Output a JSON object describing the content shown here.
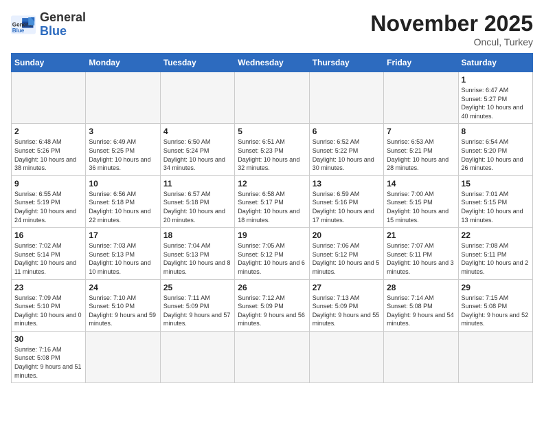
{
  "header": {
    "logo_text_general": "General",
    "logo_text_blue": "Blue",
    "month_year": "November 2025",
    "location": "Oncul, Turkey"
  },
  "weekdays": [
    "Sunday",
    "Monday",
    "Tuesday",
    "Wednesday",
    "Thursday",
    "Friday",
    "Saturday"
  ],
  "days": [
    {
      "num": "",
      "sunrise": "",
      "sunset": "",
      "daylight": "",
      "empty": true
    },
    {
      "num": "",
      "sunrise": "",
      "sunset": "",
      "daylight": "",
      "empty": true
    },
    {
      "num": "",
      "sunrise": "",
      "sunset": "",
      "daylight": "",
      "empty": true
    },
    {
      "num": "",
      "sunrise": "",
      "sunset": "",
      "daylight": "",
      "empty": true
    },
    {
      "num": "",
      "sunrise": "",
      "sunset": "",
      "daylight": "",
      "empty": true
    },
    {
      "num": "",
      "sunrise": "",
      "sunset": "",
      "daylight": "",
      "empty": true
    },
    {
      "num": "1",
      "sunrise": "Sunrise: 6:47 AM",
      "sunset": "Sunset: 5:27 PM",
      "daylight": "Daylight: 10 hours and 40 minutes.",
      "empty": false
    },
    {
      "num": "2",
      "sunrise": "Sunrise: 6:48 AM",
      "sunset": "Sunset: 5:26 PM",
      "daylight": "Daylight: 10 hours and 38 minutes.",
      "empty": false
    },
    {
      "num": "3",
      "sunrise": "Sunrise: 6:49 AM",
      "sunset": "Sunset: 5:25 PM",
      "daylight": "Daylight: 10 hours and 36 minutes.",
      "empty": false
    },
    {
      "num": "4",
      "sunrise": "Sunrise: 6:50 AM",
      "sunset": "Sunset: 5:24 PM",
      "daylight": "Daylight: 10 hours and 34 minutes.",
      "empty": false
    },
    {
      "num": "5",
      "sunrise": "Sunrise: 6:51 AM",
      "sunset": "Sunset: 5:23 PM",
      "daylight": "Daylight: 10 hours and 32 minutes.",
      "empty": false
    },
    {
      "num": "6",
      "sunrise": "Sunrise: 6:52 AM",
      "sunset": "Sunset: 5:22 PM",
      "daylight": "Daylight: 10 hours and 30 minutes.",
      "empty": false
    },
    {
      "num": "7",
      "sunrise": "Sunrise: 6:53 AM",
      "sunset": "Sunset: 5:21 PM",
      "daylight": "Daylight: 10 hours and 28 minutes.",
      "empty": false
    },
    {
      "num": "8",
      "sunrise": "Sunrise: 6:54 AM",
      "sunset": "Sunset: 5:20 PM",
      "daylight": "Daylight: 10 hours and 26 minutes.",
      "empty": false
    },
    {
      "num": "9",
      "sunrise": "Sunrise: 6:55 AM",
      "sunset": "Sunset: 5:19 PM",
      "daylight": "Daylight: 10 hours and 24 minutes.",
      "empty": false
    },
    {
      "num": "10",
      "sunrise": "Sunrise: 6:56 AM",
      "sunset": "Sunset: 5:18 PM",
      "daylight": "Daylight: 10 hours and 22 minutes.",
      "empty": false
    },
    {
      "num": "11",
      "sunrise": "Sunrise: 6:57 AM",
      "sunset": "Sunset: 5:18 PM",
      "daylight": "Daylight: 10 hours and 20 minutes.",
      "empty": false
    },
    {
      "num": "12",
      "sunrise": "Sunrise: 6:58 AM",
      "sunset": "Sunset: 5:17 PM",
      "daylight": "Daylight: 10 hours and 18 minutes.",
      "empty": false
    },
    {
      "num": "13",
      "sunrise": "Sunrise: 6:59 AM",
      "sunset": "Sunset: 5:16 PM",
      "daylight": "Daylight: 10 hours and 17 minutes.",
      "empty": false
    },
    {
      "num": "14",
      "sunrise": "Sunrise: 7:00 AM",
      "sunset": "Sunset: 5:15 PM",
      "daylight": "Daylight: 10 hours and 15 minutes.",
      "empty": false
    },
    {
      "num": "15",
      "sunrise": "Sunrise: 7:01 AM",
      "sunset": "Sunset: 5:15 PM",
      "daylight": "Daylight: 10 hours and 13 minutes.",
      "empty": false
    },
    {
      "num": "16",
      "sunrise": "Sunrise: 7:02 AM",
      "sunset": "Sunset: 5:14 PM",
      "daylight": "Daylight: 10 hours and 11 minutes.",
      "empty": false
    },
    {
      "num": "17",
      "sunrise": "Sunrise: 7:03 AM",
      "sunset": "Sunset: 5:13 PM",
      "daylight": "Daylight: 10 hours and 10 minutes.",
      "empty": false
    },
    {
      "num": "18",
      "sunrise": "Sunrise: 7:04 AM",
      "sunset": "Sunset: 5:13 PM",
      "daylight": "Daylight: 10 hours and 8 minutes.",
      "empty": false
    },
    {
      "num": "19",
      "sunrise": "Sunrise: 7:05 AM",
      "sunset": "Sunset: 5:12 PM",
      "daylight": "Daylight: 10 hours and 6 minutes.",
      "empty": false
    },
    {
      "num": "20",
      "sunrise": "Sunrise: 7:06 AM",
      "sunset": "Sunset: 5:12 PM",
      "daylight": "Daylight: 10 hours and 5 minutes.",
      "empty": false
    },
    {
      "num": "21",
      "sunrise": "Sunrise: 7:07 AM",
      "sunset": "Sunset: 5:11 PM",
      "daylight": "Daylight: 10 hours and 3 minutes.",
      "empty": false
    },
    {
      "num": "22",
      "sunrise": "Sunrise: 7:08 AM",
      "sunset": "Sunset: 5:11 PM",
      "daylight": "Daylight: 10 hours and 2 minutes.",
      "empty": false
    },
    {
      "num": "23",
      "sunrise": "Sunrise: 7:09 AM",
      "sunset": "Sunset: 5:10 PM",
      "daylight": "Daylight: 10 hours and 0 minutes.",
      "empty": false
    },
    {
      "num": "24",
      "sunrise": "Sunrise: 7:10 AM",
      "sunset": "Sunset: 5:10 PM",
      "daylight": "Daylight: 9 hours and 59 minutes.",
      "empty": false
    },
    {
      "num": "25",
      "sunrise": "Sunrise: 7:11 AM",
      "sunset": "Sunset: 5:09 PM",
      "daylight": "Daylight: 9 hours and 57 minutes.",
      "empty": false
    },
    {
      "num": "26",
      "sunrise": "Sunrise: 7:12 AM",
      "sunset": "Sunset: 5:09 PM",
      "daylight": "Daylight: 9 hours and 56 minutes.",
      "empty": false
    },
    {
      "num": "27",
      "sunrise": "Sunrise: 7:13 AM",
      "sunset": "Sunset: 5:09 PM",
      "daylight": "Daylight: 9 hours and 55 minutes.",
      "empty": false
    },
    {
      "num": "28",
      "sunrise": "Sunrise: 7:14 AM",
      "sunset": "Sunset: 5:08 PM",
      "daylight": "Daylight: 9 hours and 54 minutes.",
      "empty": false
    },
    {
      "num": "29",
      "sunrise": "Sunrise: 7:15 AM",
      "sunset": "Sunset: 5:08 PM",
      "daylight": "Daylight: 9 hours and 52 minutes.",
      "empty": false
    },
    {
      "num": "30",
      "sunrise": "Sunrise: 7:16 AM",
      "sunset": "Sunset: 5:08 PM",
      "daylight": "Daylight: 9 hours and 51 minutes.",
      "empty": false
    },
    {
      "num": "",
      "sunrise": "",
      "sunset": "",
      "daylight": "",
      "empty": true
    },
    {
      "num": "",
      "sunrise": "",
      "sunset": "",
      "daylight": "",
      "empty": true
    },
    {
      "num": "",
      "sunrise": "",
      "sunset": "",
      "daylight": "",
      "empty": true
    },
    {
      "num": "",
      "sunrise": "",
      "sunset": "",
      "daylight": "",
      "empty": true
    },
    {
      "num": "",
      "sunrise": "",
      "sunset": "",
      "daylight": "",
      "empty": true
    },
    {
      "num": "",
      "sunrise": "",
      "sunset": "",
      "daylight": "",
      "empty": true
    }
  ]
}
